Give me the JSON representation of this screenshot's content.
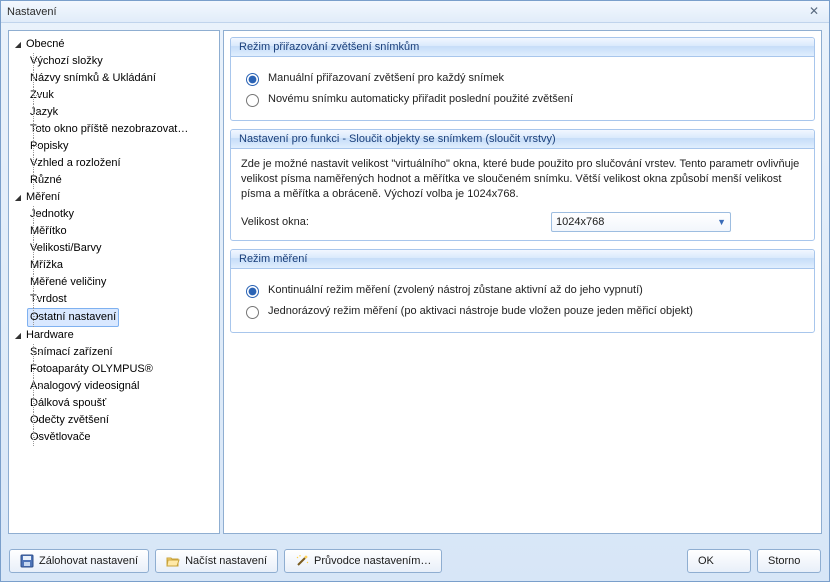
{
  "window": {
    "title": "Nastavení"
  },
  "tree": {
    "general": {
      "label": "Obecné",
      "items": [
        "Výchozí složky",
        "Názvy snímků & Ukládání",
        "Zvuk",
        "Jazyk",
        "Toto okno příště nezobrazovat…",
        "Popisky",
        "Vzhled a rozložení",
        "Různé"
      ]
    },
    "measurement": {
      "label": "Měření",
      "items": [
        "Jednotky",
        "Měřítko",
        "Velikosti/Barvy",
        "Mřížka",
        "Měřené veličiny",
        "Tvrdost",
        "Ostatní nastavení"
      ],
      "selected_index": 6
    },
    "hardware": {
      "label": "Hardware",
      "items": [
        "Snímací zařízení",
        "Fotoaparáty OLYMPUS®",
        "Analogový videosignál",
        "Dálková spoušť",
        "Odečty zvětšení",
        "Osvětlovače"
      ]
    }
  },
  "panel": {
    "group1": {
      "title": "Režim přiřazování zvětšení snímkům",
      "opt1": "Manuální přiřazovaní zvětšení pro každý snímek",
      "opt2": "Novému snímku automaticky přiřadit poslední použité zvětšení"
    },
    "group2": {
      "title": "Nastavení pro funkci - Sloučit objekty se snímkem (sloučit vrstvy)",
      "desc": "Zde je možné nastavit velikost \"virtuálního\" okna, které bude použito pro slučování vrstev. Tento parametr ovlivňuje velikost písma naměřených hodnot a měřítka ve sloučeném snímku. Větší velikost okna způsobí menší velikost písma a měřítka a obráceně. Výchozí volba je 1024x768.",
      "size_label": "Velikost okna:",
      "size_value": "1024x768"
    },
    "group3": {
      "title": "Režim měření",
      "opt1": "Kontinuální režim měření (zvolený nástroj zůstane aktivní až do jeho vypnutí)",
      "opt2": "Jednorázový režim měření (po aktivaci nástroje bude vložen pouze jeden měřicí objekt)"
    }
  },
  "footer": {
    "backup": "Zálohovat nastavení",
    "load": "Načíst nastavení",
    "wizard": "Průvodce nastavením…",
    "ok": "OK",
    "cancel": "Storno"
  }
}
